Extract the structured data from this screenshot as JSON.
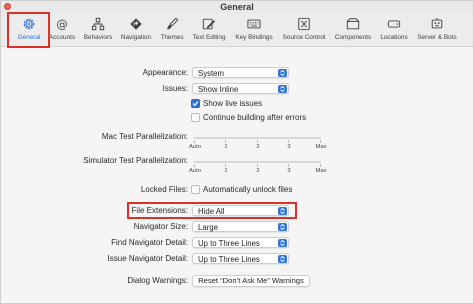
{
  "window": {
    "title": "General"
  },
  "toolbar": {
    "items": [
      {
        "label": "General",
        "icon": "gear-icon",
        "active": true
      },
      {
        "label": "Accounts",
        "icon": "at-sign-icon"
      },
      {
        "label": "Behaviors",
        "icon": "behaviors-icon"
      },
      {
        "label": "Navigation",
        "icon": "navigation-icon"
      },
      {
        "label": "Themes",
        "icon": "brush-icon"
      },
      {
        "label": "Text Editing",
        "icon": "pencil-icon"
      },
      {
        "label": "Key Bindings",
        "icon": "keyboard-icon"
      },
      {
        "label": "Source Control",
        "icon": "source-control-icon"
      },
      {
        "label": "Components",
        "icon": "components-icon"
      },
      {
        "label": "Locations",
        "icon": "drive-icon"
      },
      {
        "label": "Server & Bots",
        "icon": "server-icon"
      }
    ],
    "accent": "#2f73d8"
  },
  "settings": {
    "appearance": {
      "label": "Appearance:",
      "value": "System"
    },
    "issues": {
      "label": "Issues:",
      "value": "Show Inline"
    },
    "show_live_issues": {
      "label": "Show live issues",
      "checked": true
    },
    "continue_building": {
      "label": "Continue building after errors",
      "checked": false
    },
    "mac_test_parallel": {
      "label": "Mac Test Parallelization:",
      "ticks": [
        "Auto",
        "1",
        "2",
        "3",
        "Max"
      ]
    },
    "sim_test_parallel": {
      "label": "Simulator Test Parallelization:",
      "ticks": [
        "Auto",
        "1",
        "2",
        "3",
        "Max"
      ]
    },
    "locked_files": {
      "label": "Locked Files:",
      "checkbox_label": "Automatically unlock files",
      "checked": false
    },
    "file_extensions": {
      "label": "File Extensions:",
      "value": "Hide All"
    },
    "navigator_size": {
      "label": "Navigator Size:",
      "value": "Large"
    },
    "find_navigator_detail": {
      "label": "Find Navigator Detail:",
      "value": "Up to Three Lines"
    },
    "issue_navigator_detail": {
      "label": "Issue Navigator Detail:",
      "value": "Up to Three Lines"
    },
    "dialog_warnings": {
      "label": "Dialog Warnings:",
      "button": "Reset “Don’t Ask Me” Warnings"
    }
  },
  "highlight_color": "#d8332b"
}
